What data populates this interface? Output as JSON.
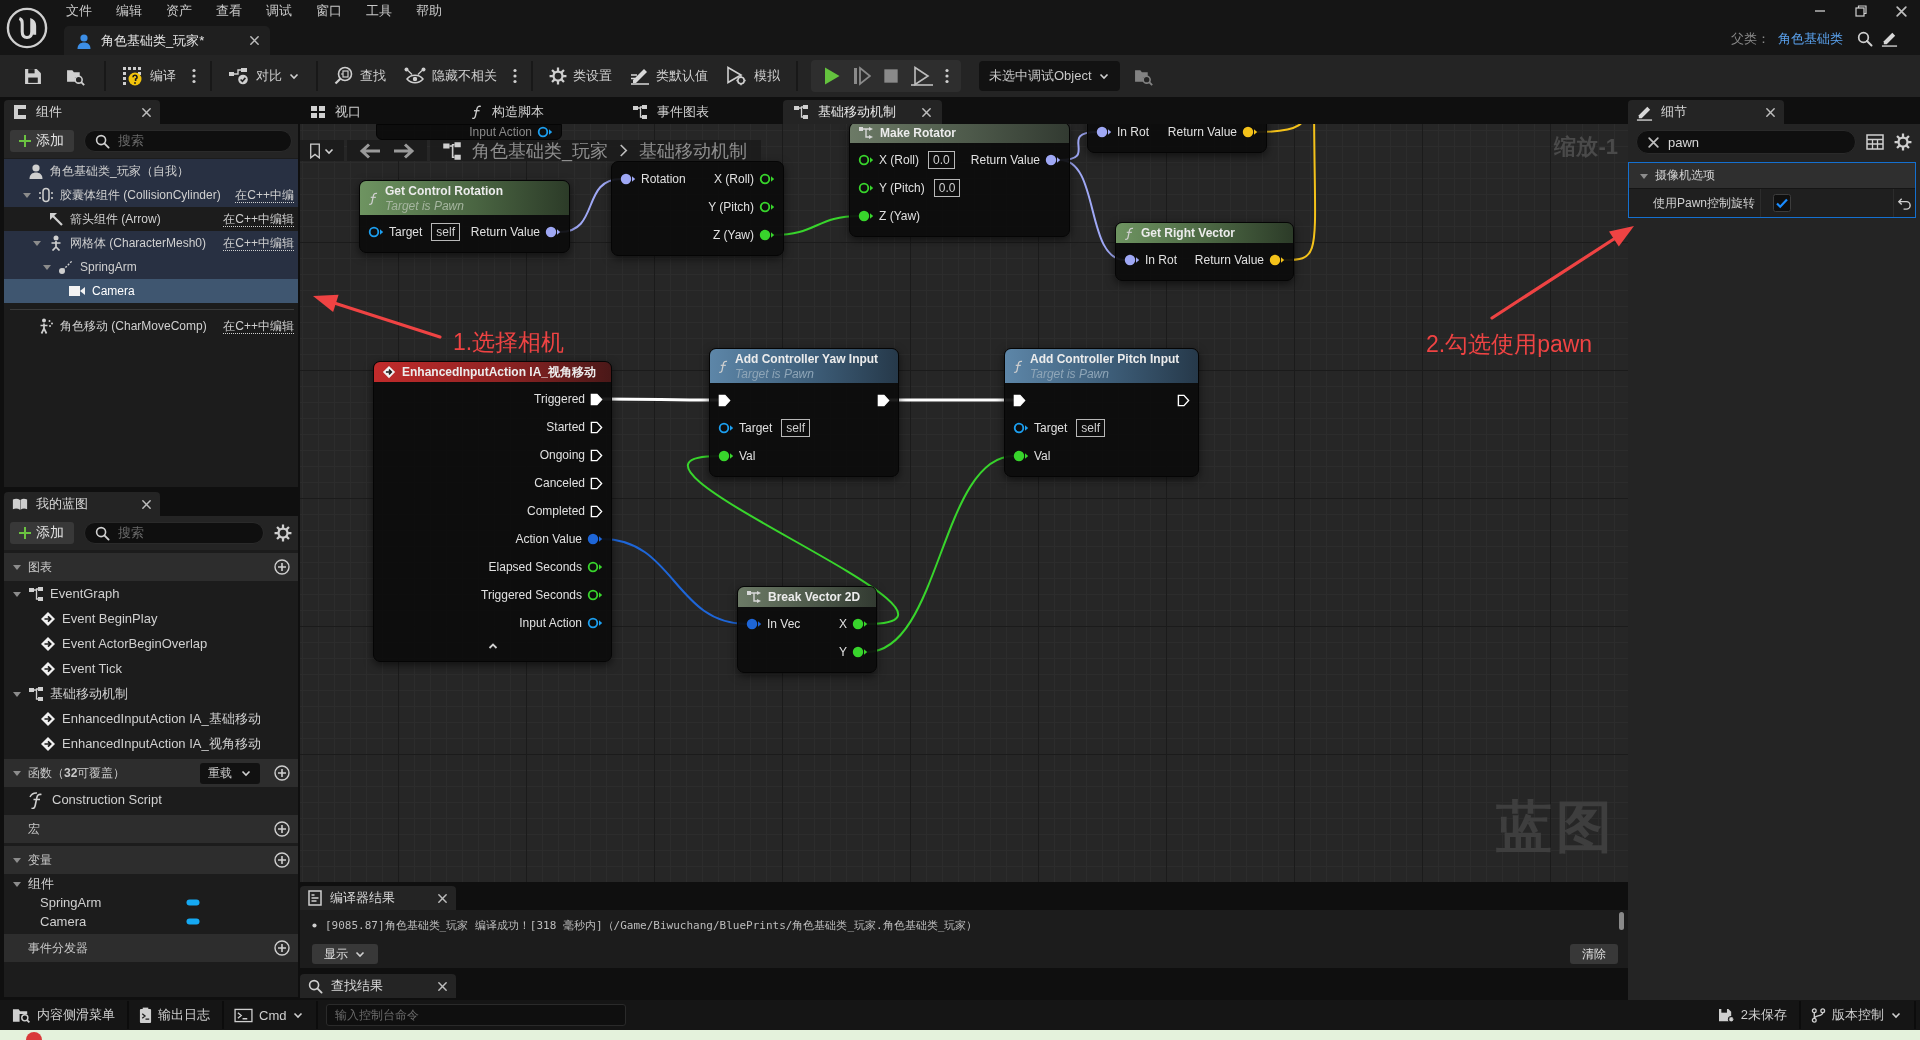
{
  "menu_bar": {
    "items": [
      "文件",
      "编辑",
      "资产",
      "查看",
      "调试",
      "窗口",
      "工具",
      "帮助"
    ]
  },
  "document_tab": {
    "title": "角色基础类_玩家*"
  },
  "parent_class": {
    "label": "父类：",
    "value": "角色基础类"
  },
  "toolbar": {
    "buttons": [
      {
        "label": "编译"
      },
      {
        "label": "对比"
      },
      {
        "label": "查找"
      },
      {
        "label": "隐藏不相关"
      },
      {
        "label": "类设置"
      },
      {
        "label": "类默认值"
      },
      {
        "label": "模拟"
      }
    ],
    "debug_object": {
      "value": "未选中调试Object"
    }
  },
  "components_panel": {
    "tab": "组件",
    "add_button": "添加",
    "search": {
      "placeholder": "搜索"
    },
    "tree": [
      {
        "label": "角色基础类_玩家（自我）",
        "kind": "actor",
        "selected": false,
        "children": [
          {
            "label": "胶囊体组件 (CollisionCylinder)",
            "kind": "capsule",
            "edit_link": "在C++中编",
            "selected": false,
            "expanded": true,
            "children": [
              {
                "label": "箭头组件 (Arrow)",
                "kind": "arrow",
                "edit_link": "在C++中编辑",
                "selected": false
              },
              {
                "label": "网格体 (CharacterMesh0)",
                "kind": "mesh",
                "edit_link": "在C++中编辑",
                "selected": false,
                "expanded": true,
                "children": [
                  {
                    "label": "SpringArm",
                    "kind": "spring_arm",
                    "selected": false,
                    "expanded": true,
                    "children": [
                      {
                        "label": "Camera",
                        "kind": "camera",
                        "selected": true
                      }
                    ]
                  }
                ]
              }
            ]
          }
        ]
      }
    ],
    "other_components": [
      {
        "label": "角色移动 (CharMoveComp)",
        "kind": "movement",
        "edit_link": "在C++中编辑",
        "selected": false
      }
    ]
  },
  "my_blueprint": {
    "tab": "我的蓝图",
    "add_button": "添加",
    "search": {
      "placeholder": "搜索"
    },
    "sections": [
      {
        "title": "图表",
        "expanded": true,
        "items": [
          {
            "label": "EventGraph",
            "kind": "graph",
            "expanded": true,
            "children": [
              {
                "label": "Event BeginPlay",
                "kind": "event"
              },
              {
                "label": "Event ActorBeginOverlap",
                "kind": "event"
              },
              {
                "label": "Event Tick",
                "kind": "event"
              }
            ]
          },
          {
            "label": "基础移动机制",
            "kind": "graph",
            "expanded": true,
            "children": [
              {
                "label": "EnhancedInputAction IA_基础移动",
                "kind": "event"
              },
              {
                "label": "EnhancedInputAction IA_视角移动",
                "kind": "event"
              }
            ]
          }
        ]
      },
      {
        "title": "函数（**32**可覆盖）",
        "expanded": true,
        "dropdown": "重载",
        "items": [
          {
            "label": "Construction Script",
            "kind": "function"
          }
        ]
      },
      {
        "title": "宏"
      },
      {
        "title": "变量",
        "expanded": true,
        "items": [
          {
            "label": "组件",
            "kind": "category",
            "expanded": true,
            "children": [
              {
                "label": "SpringArm",
                "kind": "variable"
              },
              {
                "label": "Camera",
                "kind": "variable"
              }
            ]
          }
        ]
      },
      {
        "title": "事件分发器"
      }
    ]
  },
  "graph_tabs": [
    {
      "label": "视口",
      "selected": false
    },
    {
      "label": "构造脚本",
      "selected": false
    },
    {
      "label": "事件图表",
      "selected": false
    },
    {
      "label": "基础移动机制",
      "selected": true
    }
  ],
  "graph": {
    "breadcrumb": [
      "角色基础类_玩家",
      "基础移动机制"
    ],
    "zoom_label": "缩放-1",
    "type_label": "蓝图",
    "nodes": [
      {
        "kind": "event",
        "outputs": [
          {
            "name": "Input Action",
            "kind": "object",
            "connected": false
          }
        ]
      },
      {
        "kind": "struct",
        "inputs": [
          {
            "name": "Rotation",
            "kind": "rotator",
            "connected": true
          }
        ],
        "outputs": [
          {
            "name": "X (Roll)",
            "kind": "float",
            "connected": false
          },
          {
            "name": "Y (Pitch)",
            "kind": "float",
            "connected": false
          },
          {
            "name": "Z (Yaw)",
            "kind": "float",
            "connected": true
          }
        ]
      },
      {
        "kind": "struct",
        "title": "Make Rotator",
        "inputs": [
          {
            "name": "X (Roll)",
            "kind": "float",
            "connected": false,
            "default": "0.0"
          },
          {
            "name": "Y (Pitch)",
            "kind": "float",
            "connected": false,
            "default": "0.0"
          },
          {
            "name": "Z (Yaw)",
            "kind": "float",
            "connected": true
          }
        ],
        "outputs": [
          {
            "name": "Return Value",
            "kind": "rotator",
            "connected": true
          }
        ]
      },
      {
        "kind": "function",
        "inputs": [
          {
            "name": "In Rot",
            "kind": "rotator",
            "connected": true
          }
        ],
        "outputs": [
          {
            "name": "Return Value",
            "kind": "vector",
            "connected": true
          }
        ]
      },
      {
        "kind": "function",
        "title": "Get Control Rotation",
        "subtitle": "Target is Pawn",
        "inputs": [
          {
            "name": "Target",
            "kind": "object",
            "connected": false,
            "default": "self"
          }
        ],
        "outputs": [
          {
            "name": "Return Value",
            "kind": "rotator",
            "connected": true
          }
        ]
      },
      {
        "kind": "function",
        "title": "Get Right Vector",
        "inputs": [
          {
            "name": "In Rot",
            "kind": "rotator",
            "connected": true
          }
        ],
        "outputs": [
          {
            "name": "Return Value",
            "kind": "vector",
            "connected": true
          }
        ]
      },
      {
        "kind": "event",
        "title": "EnhancedInputAction IA_视角移动",
        "advanced_expanded": true,
        "outputs": [
          {
            "name": "Triggered",
            "kind": "exec",
            "connected": true
          },
          {
            "name": "Started",
            "kind": "exec",
            "connected": false
          },
          {
            "name": "Ongoing",
            "kind": "exec",
            "connected": false
          },
          {
            "name": "Canceled",
            "kind": "exec",
            "connected": false
          },
          {
            "name": "Completed",
            "kind": "exec",
            "connected": false
          },
          {
            "name": "Action Value",
            "kind": "vector2d",
            "connected": true
          },
          {
            "name": "Elapsed Seconds",
            "kind": "float",
            "connected": false
          },
          {
            "name": "Triggered Seconds",
            "kind": "float",
            "connected": false
          },
          {
            "name": "Input Action",
            "kind": "object",
            "connected": false
          }
        ]
      },
      {
        "kind": "call",
        "title": "Add Controller Yaw Input",
        "subtitle": "Target is Pawn",
        "inputs": [
          {
            "kind": "exec",
            "connected": true
          },
          {
            "name": "Target",
            "kind": "object",
            "connected": false,
            "default": "self"
          },
          {
            "name": "Val",
            "kind": "float",
            "connected": true
          }
        ],
        "outputs": [
          {
            "kind": "exec",
            "connected": true
          }
        ]
      },
      {
        "kind": "call",
        "title": "Add Controller Pitch Input",
        "subtitle": "Target is Pawn",
        "inputs": [
          {
            "kind": "exec",
            "connected": true
          },
          {
            "name": "Target",
            "kind": "object",
            "connected": false,
            "default": "self"
          },
          {
            "name": "Val",
            "kind": "float",
            "connected": true
          }
        ],
        "outputs": [
          {
            "kind": "exec",
            "connected": false
          }
        ]
      },
      {
        "kind": "struct",
        "title": "Break Vector 2D",
        "inputs": [
          {
            "name": "In Vec",
            "kind": "vector2d",
            "connected": true
          }
        ],
        "outputs": [
          {
            "name": "X",
            "kind": "float",
            "connected": true
          },
          {
            "name": "Y",
            "kind": "float",
            "connected": true
          }
        ]
      }
    ]
  },
  "annotations": [
    {
      "text": "1.选择相机"
    },
    {
      "text": "2.勾选使用pawn"
    }
  ],
  "compiler_results": {
    "tab": "编译器结果",
    "messages": [
      "[9085.87]角色基础类_玩家 编译成功！[318 毫秒内]（/Game/Biwuchang/BluePrints/角色基础类_玩家.角色基础类_玩家）"
    ],
    "show_button": "显示",
    "clear_button": "清除"
  },
  "find_results": {
    "tab": "查找结果"
  },
  "details": {
    "tab": "细节",
    "search": {
      "value": "pawn"
    },
    "categories": [
      {
        "title": "摄像机选项",
        "expanded": true,
        "properties": [
          {
            "label": "使用Pawn控制旋转",
            "kind": "checkbox",
            "checked": true
          }
        ]
      }
    ]
  },
  "status_bar": {
    "content_drawer": "内容侧滑菜单",
    "output_log": "输出日志",
    "cmd": "Cmd",
    "console": {
      "placeholder": "输入控制台命令"
    },
    "unsaved": "2未保存",
    "source_control": "版本控制"
  }
}
